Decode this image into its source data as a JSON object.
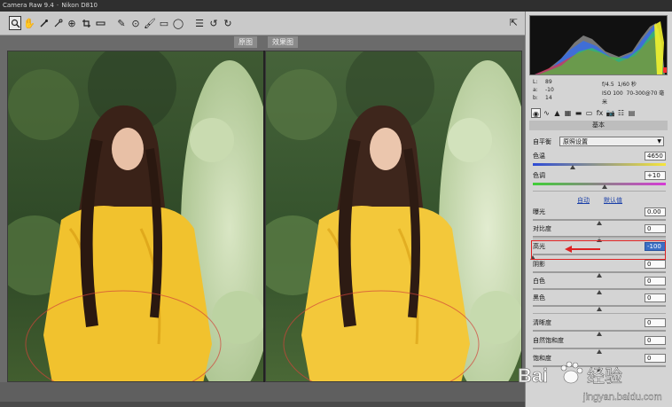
{
  "titlebar": {
    "app": "Camera Raw 9.4",
    "camera": "Nikon D810"
  },
  "toolbar": {
    "tools": [
      "zoom-tool",
      "hand-tool",
      "white-balance-tool",
      "color-sampler-tool",
      "crop-tool",
      "straighten-tool",
      "transform-tool",
      "spot-removal-tool",
      "red-eye-tool",
      "adjustment-brush-tool",
      "graduated-filter-tool",
      "radial-filter-tool",
      "preferences",
      "rotate-left",
      "rotate-right"
    ],
    "fullscreen_icon": "fullscreen-icon"
  },
  "preview": {
    "before_label": "原图",
    "after_label": "效果图"
  },
  "info": {
    "r_label": "L:",
    "r_value": "89",
    "g_label": "a:",
    "g_value": "-10",
    "b_label": "b:",
    "b_value": "14",
    "aperture": "f/4.5",
    "shutter": "1/60 秒",
    "iso": "ISO 100",
    "lens": "70-300@70 毫米"
  },
  "panel": {
    "section_title": "基本",
    "wb_label": "自平衡",
    "wb_value": "原照设置",
    "controls": {
      "temp": {
        "label": "色温",
        "value": "4650",
        "level": 0.3
      },
      "tint": {
        "label": "色调",
        "value": "+10",
        "level": 0.54
      },
      "exposure": {
        "label": "曝光",
        "value": "0.00",
        "level": 0.5
      },
      "contrast": {
        "label": "对比度",
        "value": "0",
        "level": 0.5
      },
      "highlights": {
        "label": "高光",
        "value": "-100",
        "level": 0.0
      },
      "shadows": {
        "label": "阴影",
        "value": "0",
        "level": 0.5
      },
      "whites": {
        "label": "白色",
        "value": "0",
        "level": 0.5
      },
      "blacks": {
        "label": "黑色",
        "value": "0",
        "level": 0.5
      },
      "clarity": {
        "label": "清晰度",
        "value": "0",
        "level": 0.5
      },
      "vibrance": {
        "label": "自然饱和度",
        "value": "0",
        "level": 0.5
      },
      "saturation": {
        "label": "饱和度",
        "value": "0",
        "level": 0.5
      }
    },
    "auto_label": "自动",
    "default_label": "默认值"
  },
  "watermark": {
    "brand": "Bai",
    "brand2": "经验",
    "url": "jingyan.baidu.com"
  },
  "colors": {
    "panel_bg": "#d4d4d4",
    "accent": "#3b6ec4",
    "annotation": "#dd2222"
  }
}
